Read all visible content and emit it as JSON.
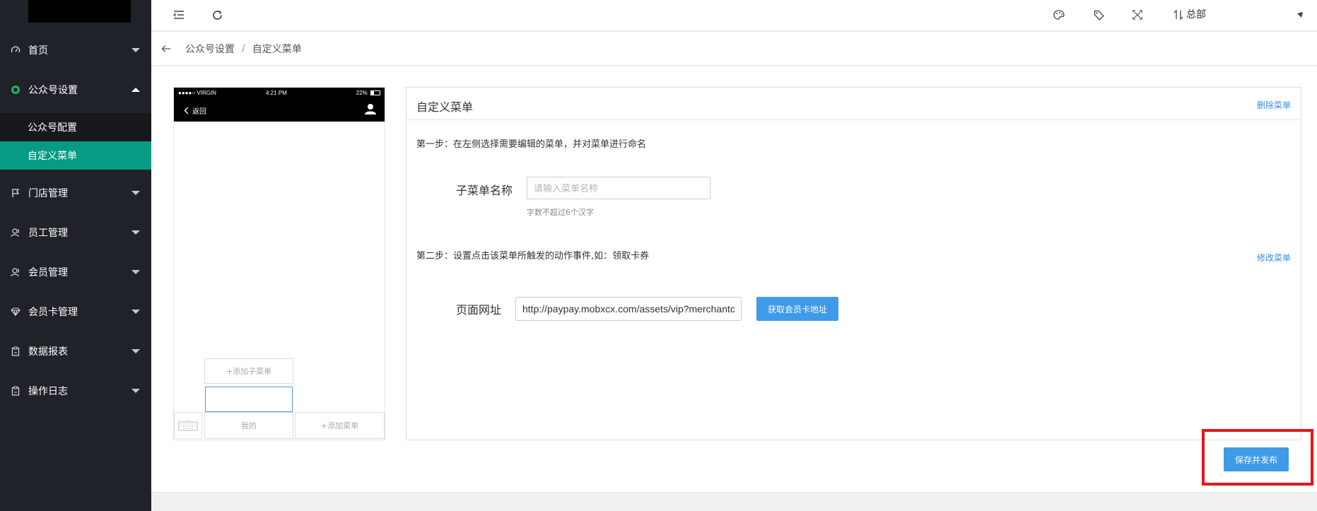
{
  "sidebar": {
    "items": [
      {
        "label": "首页",
        "icon": "dashboard-icon",
        "expanded": false
      },
      {
        "label": "公众号设置",
        "icon": "wechat-icon",
        "expanded": true
      },
      {
        "label": "门店管理",
        "icon": "flag-icon",
        "expanded": false
      },
      {
        "label": "员工管理",
        "icon": "users-icon",
        "expanded": false
      },
      {
        "label": "会员管理",
        "icon": "users-icon",
        "expanded": false
      },
      {
        "label": "会员卡管理",
        "icon": "diamond-icon",
        "expanded": false
      },
      {
        "label": "数据报表",
        "icon": "clipboard-icon",
        "expanded": false
      },
      {
        "label": "操作日志",
        "icon": "clipboard-icon",
        "expanded": false
      }
    ],
    "sub_items": [
      {
        "label": "公众号配置",
        "active": false
      },
      {
        "label": "自定义菜单",
        "active": true
      }
    ],
    "accent_color": "#079b84"
  },
  "topbar": {
    "branch_label": "总部"
  },
  "breadcrumb": {
    "parent": "公众号设置",
    "separator": "/",
    "current": "自定义菜单"
  },
  "phone": {
    "carrier": "●●●●○ VIRGIN",
    "time": "4:21 PM",
    "battery": "22%",
    "back_label": "返回",
    "add_submenu": "+添加子菜单",
    "selected_submenu": "",
    "menu_mine": "我的",
    "add_menu": "+添加菜单"
  },
  "editor": {
    "title": "自定义菜单",
    "delete_link": "删除菜单",
    "step1": "第一步：在左侧选择需要编辑的菜单，并对菜单进行命名",
    "submenu_name_label": "子菜单名称",
    "submenu_name_placeholder": "请输入菜单名称",
    "submenu_name_value": "",
    "submenu_hint": "字数不超过6个汉字",
    "step2": "第二步：设置点击该菜单所触发的动作事件,如：领取卡券",
    "modify_link": "修改菜单",
    "url_label": "页面网址",
    "url_value": "http://paypay.mobxcx.com/assets/vip?merchantc",
    "get_card_button": "获取会员卡地址"
  },
  "save_button": "保存并发布"
}
